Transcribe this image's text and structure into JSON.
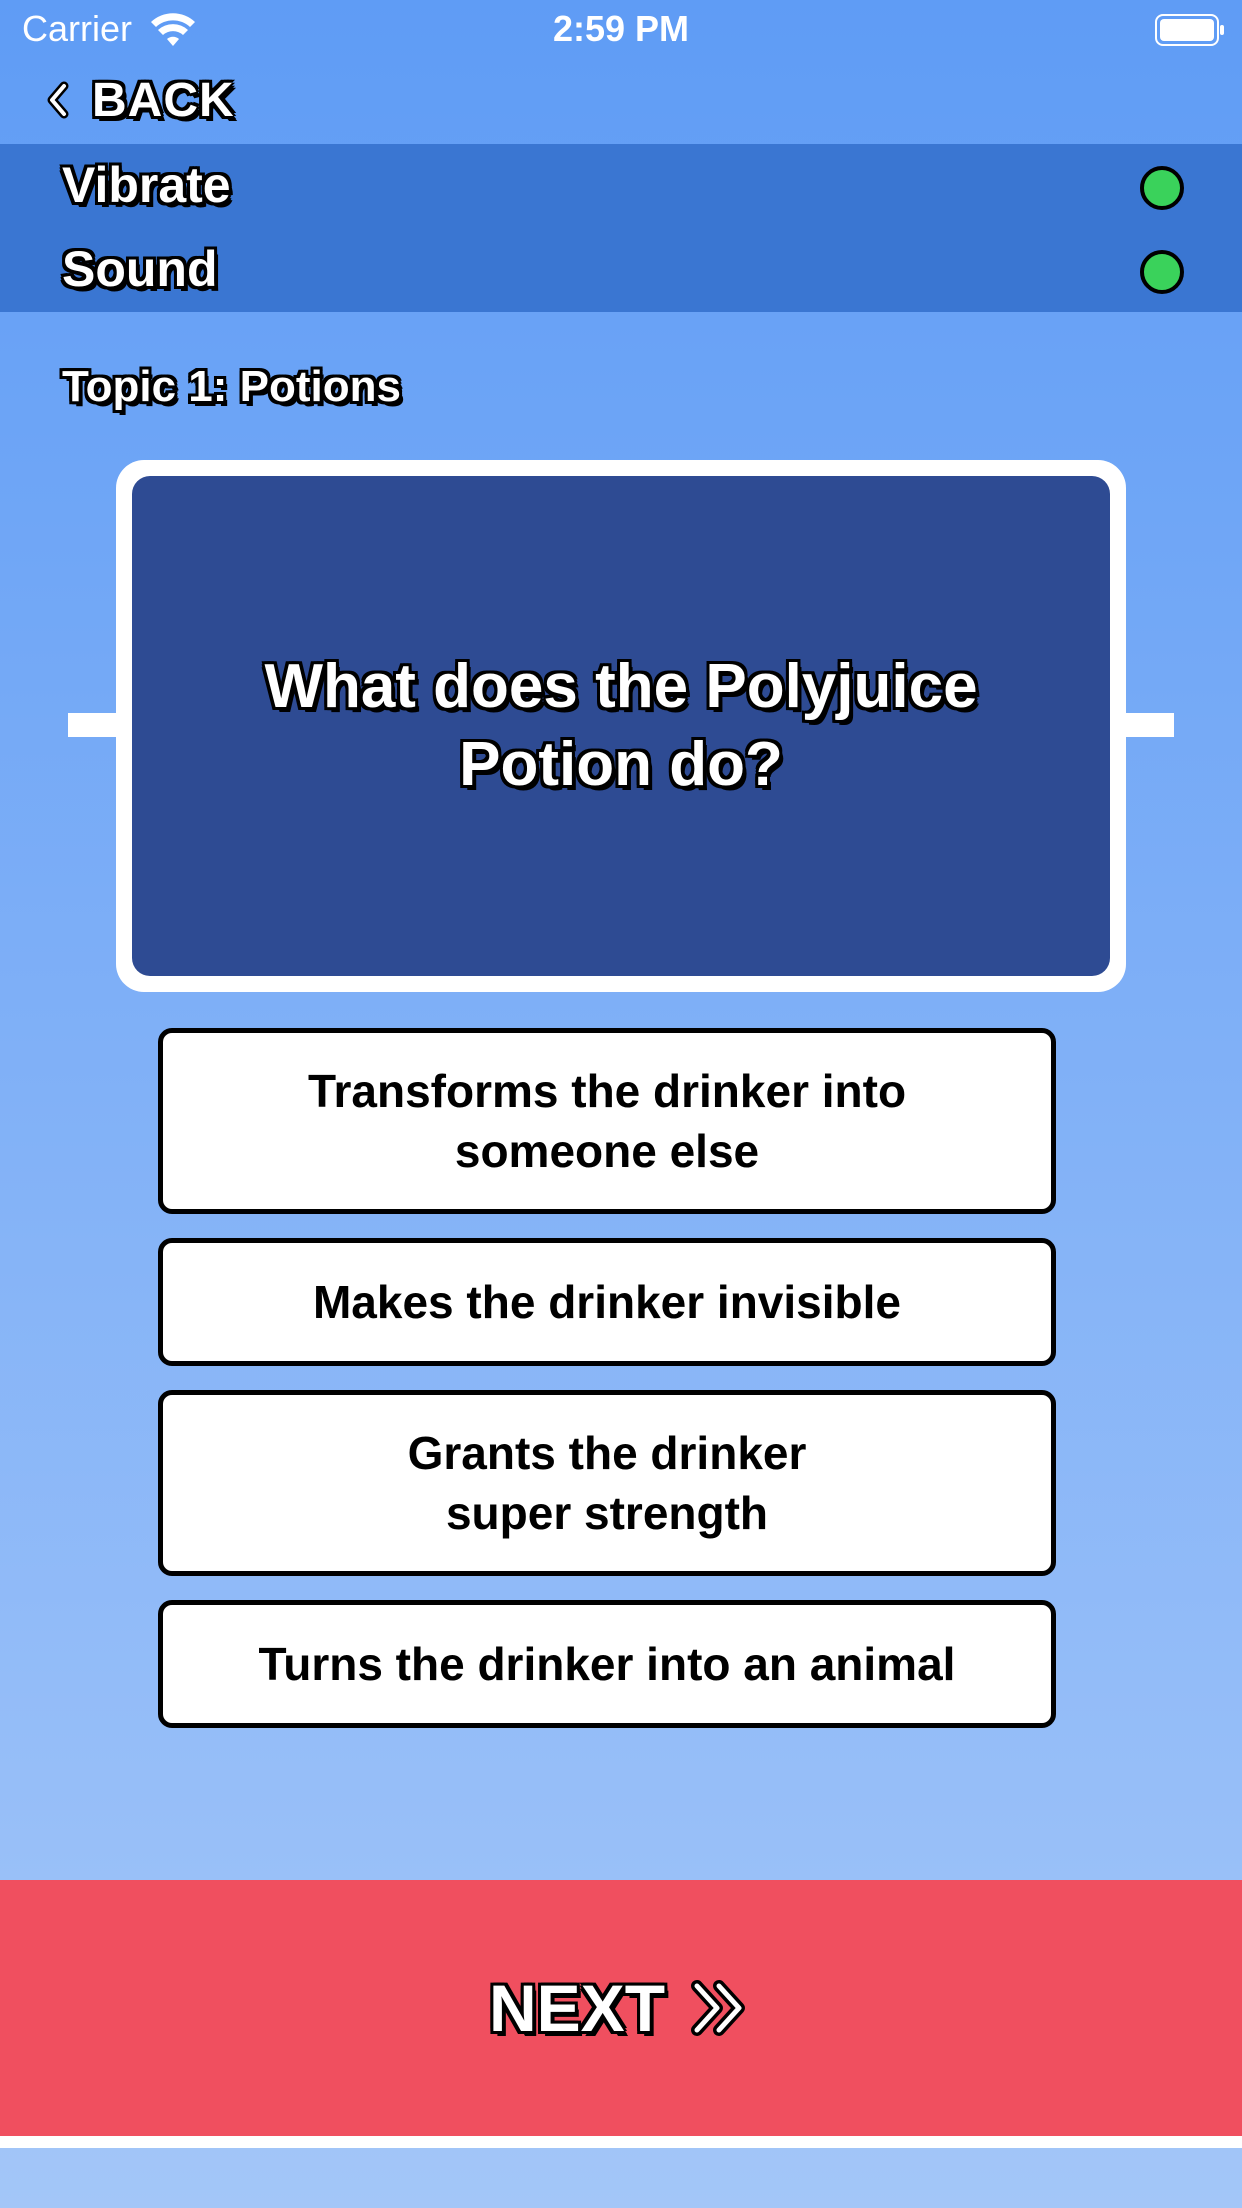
{
  "status_bar": {
    "carrier": "Carrier",
    "time": "2:59 PM"
  },
  "nav": {
    "back_label": "BACK"
  },
  "settings": [
    {
      "label": "Vibrate",
      "enabled": true
    },
    {
      "label": "Sound",
      "enabled": true
    }
  ],
  "quiz": {
    "topic": "Topic 1: Potions",
    "question": "What does the Polyjuice Potion do?",
    "answers": [
      "Transforms the drinker into someone else",
      "Makes the drinker invisible",
      "Grants the drinker super strength",
      "Turns the drinker into an animal"
    ]
  },
  "next_label": "NEXT",
  "colors": {
    "background": "#5f9cf5",
    "settings_band": "#3a76d2",
    "question_card": "#2e4b93",
    "toggle_on": "#3ad25b",
    "next_bar": "#f04f5f"
  },
  "icons": {
    "back": "chevron-left-icon",
    "next": "double-chevron-right-icon",
    "wifi": "wifi-icon",
    "battery": "battery-icon"
  }
}
